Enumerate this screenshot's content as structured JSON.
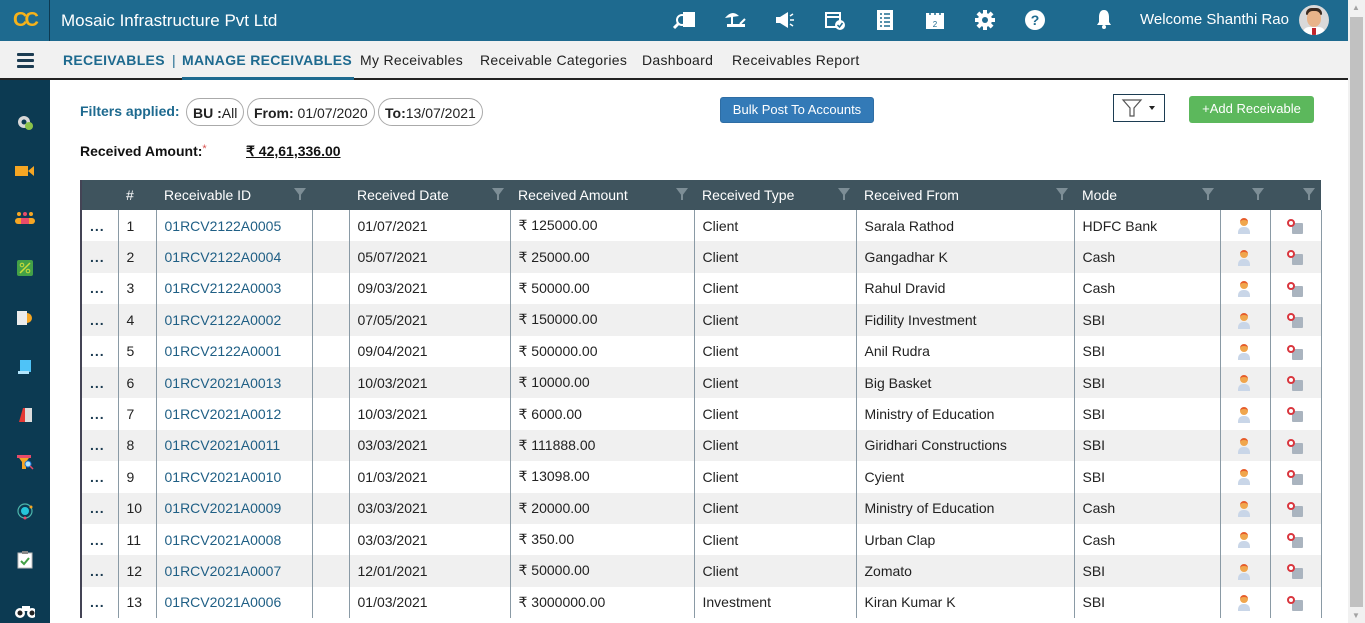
{
  "app": {
    "logo_text": "CC",
    "company": "Mosaic Infrastructure Pvt Ltd",
    "welcome": "Welcome Shanthi Rao",
    "top_icons": [
      "search-document-icon",
      "vacation-icon",
      "announcement-icon",
      "calendar-check-icon",
      "checklist-icon",
      "calendar-icon",
      "gear-icon",
      "help-icon"
    ]
  },
  "subnav": {
    "section": "RECEIVABLES",
    "separator": "|",
    "active": "MANAGE RECEIVABLES",
    "links": [
      "My Receivables",
      "Receivable Categories",
      "Dashboard",
      "Receivables Report"
    ]
  },
  "sidebar": {
    "icons": [
      "settings-user-icon",
      "video-icon",
      "team-icon",
      "percent-icon",
      "report-icon",
      "notes-icon",
      "book-icon",
      "filter-search-icon",
      "target-icon",
      "clipboard-check-icon",
      "binoculars-icon"
    ]
  },
  "filters": {
    "label": "Filters applied:",
    "chips": [
      {
        "key": "BU :",
        "value": "All"
      },
      {
        "key": "From:",
        "value": " 01/07/2020"
      },
      {
        "key": "To:",
        "value": "13/07/2021"
      }
    ]
  },
  "actions": {
    "bulk_post": "Bulk Post To Accounts",
    "add_receivable": "+Add Receivable"
  },
  "summary": {
    "label": "Received Amount:",
    "required_mark": "*",
    "value": "₹ 42,61,336.00"
  },
  "table": {
    "columns": [
      "",
      "#",
      "Receivable ID",
      "",
      "Received Date",
      "Received Amount",
      "Received Type",
      "Received From",
      "Mode",
      "",
      ""
    ],
    "rows": [
      {
        "n": "1",
        "id": "01RCV2122A0005",
        "date": "01/07/2021",
        "amount": "₹ 125000.00",
        "type": "Client",
        "from": "Sarala Rathod",
        "mode": "HDFC Bank"
      },
      {
        "n": "2",
        "id": "01RCV2122A0004",
        "date": "05/07/2021",
        "amount": "₹ 25000.00",
        "type": "Client",
        "from": "Gangadhar K",
        "mode": "Cash"
      },
      {
        "n": "3",
        "id": "01RCV2122A0003",
        "date": "09/03/2021",
        "amount": "₹ 50000.00",
        "type": "Client",
        "from": "Rahul Dravid",
        "mode": "Cash"
      },
      {
        "n": "4",
        "id": "01RCV2122A0002",
        "date": "07/05/2021",
        "amount": "₹ 150000.00",
        "type": "Client",
        "from": "Fidility Investment",
        "mode": "SBI"
      },
      {
        "n": "5",
        "id": "01RCV2122A0001",
        "date": "09/04/2021",
        "amount": "₹ 500000.00",
        "type": "Client",
        "from": "Anil Rudra",
        "mode": "SBI"
      },
      {
        "n": "6",
        "id": "01RCV2021A0013",
        "date": "10/03/2021",
        "amount": "₹ 10000.00",
        "type": "Client",
        "from": "Big Basket",
        "mode": "SBI"
      },
      {
        "n": "7",
        "id": "01RCV2021A0012",
        "date": "10/03/2021",
        "amount": "₹ 6000.00",
        "type": "Client",
        "from": "Ministry of Education",
        "mode": "SBI"
      },
      {
        "n": "8",
        "id": "01RCV2021A0011",
        "date": "03/03/2021",
        "amount": "₹ 111888.00",
        "type": "Client",
        "from": "Giridhari Constructions",
        "mode": "SBI"
      },
      {
        "n": "9",
        "id": "01RCV2021A0010",
        "date": "01/03/2021",
        "amount": "₹ 13098.00",
        "type": "Client",
        "from": "Cyient",
        "mode": "SBI"
      },
      {
        "n": "10",
        "id": "01RCV2021A0009",
        "date": "03/03/2021",
        "amount": "₹ 20000.00",
        "type": "Client",
        "from": "Ministry of Education",
        "mode": "Cash"
      },
      {
        "n": "11",
        "id": "01RCV2021A0008",
        "date": "03/03/2021",
        "amount": "₹ 350.00",
        "type": "Client",
        "from": "Urban Clap",
        "mode": "Cash"
      },
      {
        "n": "12",
        "id": "01RCV2021A0007",
        "date": "12/01/2021",
        "amount": "₹ 50000.00",
        "type": "Client",
        "from": "Zomato",
        "mode": "SBI"
      },
      {
        "n": "13",
        "id": "01RCV2021A0006",
        "date": "01/03/2021",
        "amount": "₹ 3000000.00",
        "type": "Investment",
        "from": "Kiran Kumar K",
        "mode": "SBI"
      }
    ],
    "row_action_label": "..."
  }
}
